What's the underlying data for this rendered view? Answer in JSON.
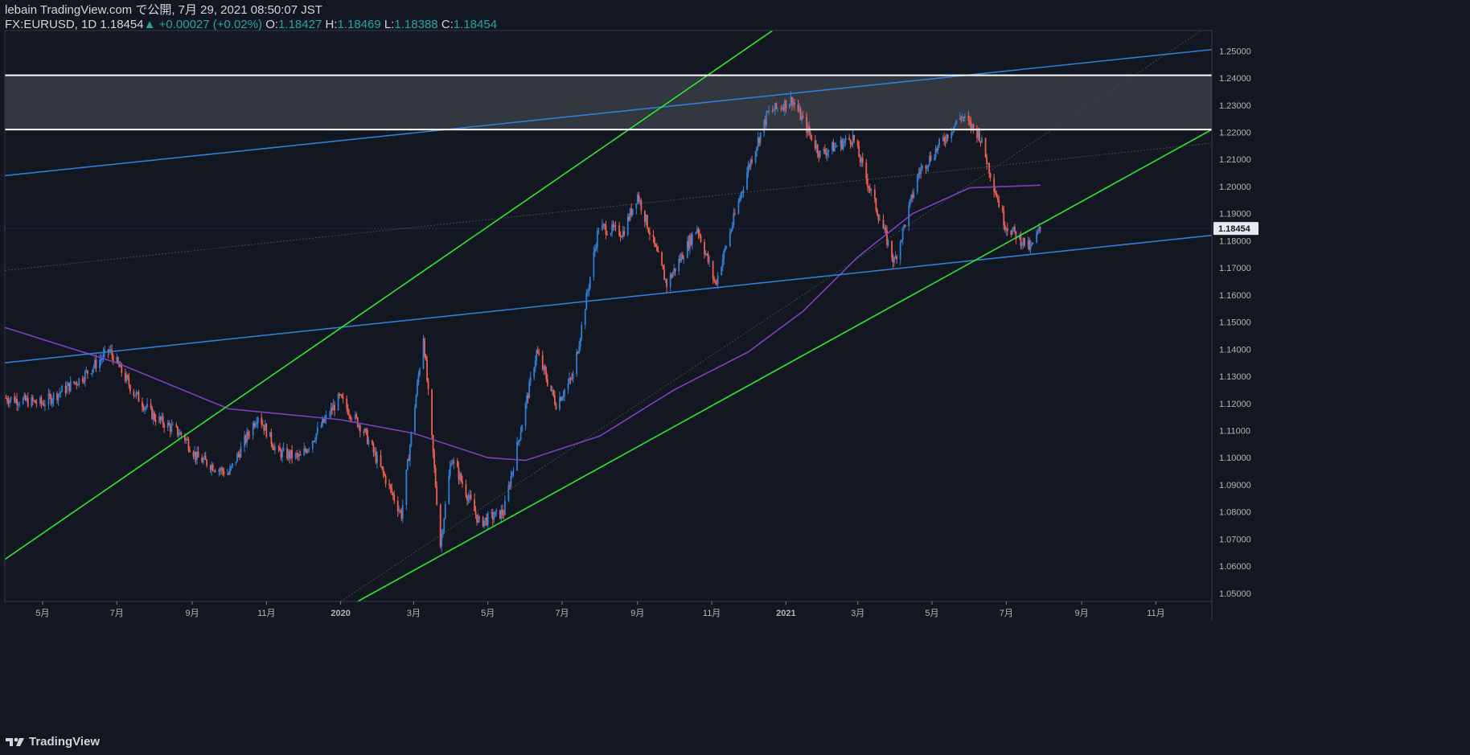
{
  "header": {
    "publish_line": "lebain TradingView.com で公開, 7月 29, 2021 08:50:07 JST",
    "symbol": "FX:EURUSD, 1D",
    "last": "1.18454",
    "change": "+0.00027 (+0.02%)",
    "open_label": "O:",
    "open": "1.18427",
    "high_label": "H:",
    "high": "1.18469",
    "low_label": "L:",
    "low": "1.18388",
    "close_label": "C:",
    "close": "1.18454"
  },
  "footer": {
    "brand": "TradingView",
    "logo_icon": "tradingview-logo-icon"
  },
  "colors": {
    "background": "#131722",
    "up": "#2f7fd6",
    "down": "#ef5f50",
    "channel": "#2ee82e",
    "trendline": "#2f7fd6",
    "ma": "#7e3fc2",
    "resistance": "#ffffff",
    "zone": "#3a3d45"
  },
  "chart_data": {
    "type": "candlestick",
    "symbol": "EURUSD",
    "interval": "1D",
    "x_axis_labels": [
      "5月",
      "7月",
      "9月",
      "11月",
      "2020",
      "3月",
      "5月",
      "7月",
      "9月",
      "11月",
      "2021",
      "3月",
      "5月",
      "7月",
      "9月",
      "11月"
    ],
    "y_axis_labels": [
      "1.25000",
      "1.24000",
      "1.23000",
      "1.22000",
      "1.21000",
      "1.20000",
      "1.19000",
      "1.18000",
      "1.17000",
      "1.16000",
      "1.15000",
      "1.14000",
      "1.13000",
      "1.12000",
      "1.11000",
      "1.10000",
      "1.09000",
      "1.08000",
      "1.07000",
      "1.06000",
      "1.05000"
    ],
    "ylim": [
      1.047,
      1.2575
    ],
    "xlim": [
      "2019-03-31",
      "2021-12-17"
    ],
    "last_price_label": "1.18454",
    "price_path_monthly": [
      [
        "2019-04-01",
        1.122
      ],
      [
        "2019-05-01",
        1.12
      ],
      [
        "2019-06-01",
        1.129
      ],
      [
        "2019-06-25",
        1.1395
      ],
      [
        "2019-07-15",
        1.124
      ],
      [
        "2019-08-01",
        1.115
      ],
      [
        "2019-08-25",
        1.108
      ],
      [
        "2019-09-05",
        1.1
      ],
      [
        "2019-10-01",
        1.094
      ],
      [
        "2019-10-25",
        1.116
      ],
      [
        "2019-11-10",
        1.102
      ],
      [
        "2019-11-29",
        1.1
      ],
      [
        "2019-12-31",
        1.122
      ],
      [
        "2020-01-20",
        1.11
      ],
      [
        "2020-02-20",
        1.079
      ],
      [
        "2020-03-09",
        1.145
      ],
      [
        "2020-03-23",
        1.068
      ],
      [
        "2020-04-01",
        1.1
      ],
      [
        "2020-04-24",
        1.076
      ],
      [
        "2020-05-14",
        1.08
      ],
      [
        "2020-06-10",
        1.139
      ],
      [
        "2020-06-26",
        1.12
      ],
      [
        "2020-07-10",
        1.13
      ],
      [
        "2020-07-31",
        1.185
      ],
      [
        "2020-08-20",
        1.183
      ],
      [
        "2020-09-01",
        1.197
      ],
      [
        "2020-09-25",
        1.164
      ],
      [
        "2020-10-20",
        1.185
      ],
      [
        "2020-11-04",
        1.164
      ],
      [
        "2020-12-01",
        1.207
      ],
      [
        "2020-12-17",
        1.227
      ],
      [
        "2021-01-06",
        1.232
      ],
      [
        "2021-01-29",
        1.212
      ],
      [
        "2021-02-25",
        1.218
      ],
      [
        "2021-03-31",
        1.172
      ],
      [
        "2021-04-20",
        1.205
      ],
      [
        "2021-05-25",
        1.226
      ],
      [
        "2021-06-09",
        1.219
      ],
      [
        "2021-06-30",
        1.186
      ],
      [
        "2021-07-21",
        1.177
      ],
      [
        "2021-07-29",
        1.1845
      ]
    ],
    "moving_average": [
      [
        "2019-03-31",
        1.148
      ],
      [
        "2019-07-01",
        1.135
      ],
      [
        "2019-10-01",
        1.118
      ],
      [
        "2020-01-01",
        1.114
      ],
      [
        "2020-03-01",
        1.109
      ],
      [
        "2020-05-01",
        1.1
      ],
      [
        "2020-06-01",
        1.099
      ],
      [
        "2020-08-01",
        1.108
      ],
      [
        "2020-10-01",
        1.125
      ],
      [
        "2020-12-01",
        1.139
      ],
      [
        "2021-01-15",
        1.154
      ],
      [
        "2021-03-01",
        1.174
      ],
      [
        "2021-04-15",
        1.19
      ],
      [
        "2021-06-01",
        1.1995
      ],
      [
        "2021-07-29",
        1.2005
      ]
    ],
    "resistance_zone": [
      1.221,
      1.241
    ],
    "green_channel_upper": [
      [
        "2019-03-31",
        1.0625
      ],
      [
        "2021-05-01",
        1.298
      ]
    ],
    "green_channel_lower": [
      [
        "2020-01-15",
        1.047
      ],
      [
        "2021-12-17",
        1.221
      ]
    ],
    "blue_upper_trendline": [
      [
        "2019-03-31",
        1.204
      ],
      [
        "2021-12-17",
        1.2505
      ]
    ],
    "blue_lower_trendline": [
      [
        "2019-03-31",
        1.135
      ],
      [
        "2021-12-17",
        1.182
      ]
    ],
    "faint_lines": [
      [
        [
          "2019-03-31",
          1.169
        ],
        [
          "2021-12-17",
          1.216
        ]
      ],
      [
        [
          "2020-01-01",
          1.047
        ],
        [
          "2021-12-17",
          1.26
        ]
      ]
    ]
  }
}
